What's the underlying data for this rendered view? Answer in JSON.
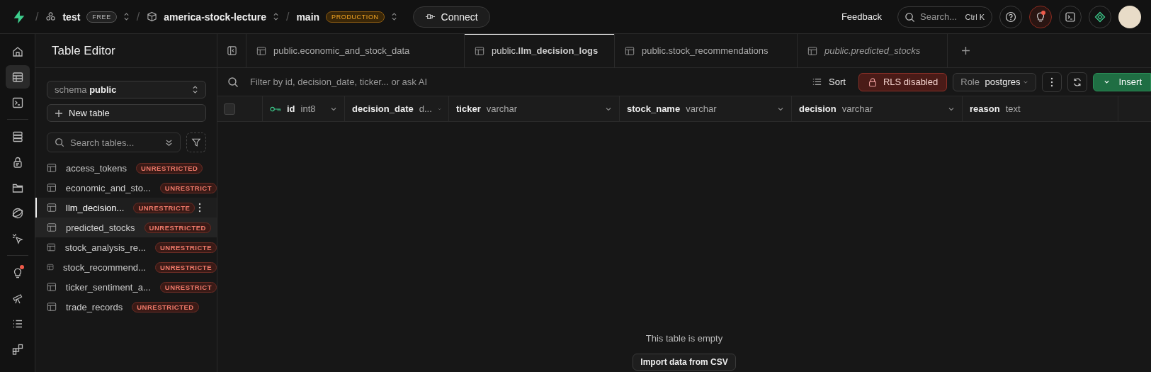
{
  "top_bar": {
    "separator": "/",
    "breadcrumbs": [
      {
        "kind": "org",
        "label": "test",
        "badge": "FREE"
      },
      {
        "kind": "project",
        "label": "america-stock-lecture"
      },
      {
        "kind": "branch",
        "label": "main",
        "badge": "PRODUCTION"
      }
    ],
    "connect_button": "Connect",
    "feedback": "Feedback",
    "search": {
      "placeholder": "Search...",
      "shortcut": "Ctrl K"
    },
    "actions": [
      {
        "kind": "help",
        "notification": false
      },
      {
        "kind": "bulb",
        "notification": true
      },
      {
        "kind": "terminal",
        "notification": false
      },
      {
        "kind": "diamond",
        "notification": false
      }
    ]
  },
  "rail": [
    {
      "kind": "home",
      "selected": false,
      "notification": false
    },
    {
      "kind": "table",
      "selected": true,
      "notification": false
    },
    {
      "kind": "terminal",
      "selected": false,
      "notification": false
    },
    {
      "kind": "sep"
    },
    {
      "kind": "database",
      "selected": false,
      "notification": false
    },
    {
      "kind": "lock",
      "selected": false,
      "notification": false
    },
    {
      "kind": "folder",
      "selected": false,
      "notification": false
    },
    {
      "kind": "globe",
      "selected": false,
      "notification": false
    },
    {
      "kind": "cursor",
      "selected": false,
      "notification": false
    },
    {
      "kind": "sep"
    },
    {
      "kind": "bulb",
      "selected": false,
      "notification": true
    },
    {
      "kind": "telescope",
      "selected": false,
      "notification": false
    },
    {
      "kind": "list",
      "selected": false,
      "notification": false
    },
    {
      "kind": "blocks",
      "selected": false,
      "notification": false
    }
  ],
  "sidebar": {
    "title": "Table Editor",
    "schema": {
      "label": "schema",
      "value": "public"
    },
    "new_table": "New table",
    "search": {
      "placeholder": "Search tables..."
    },
    "items": [
      {
        "name": "access_tokens",
        "badge": "UNRESTRICTED",
        "selected": false,
        "hovered": false
      },
      {
        "name": "economic_and_sto...",
        "badge": "UNRESTRICT",
        "selected": false,
        "hovered": false
      },
      {
        "name": "llm_decision...",
        "badge": "UNRESTRICTE",
        "selected": true,
        "hovered": false
      },
      {
        "name": "predicted_stocks",
        "badge": "UNRESTRICTED",
        "selected": false,
        "hovered": true
      },
      {
        "name": "stock_analysis_re...",
        "badge": "UNRESTRICTE",
        "selected": false,
        "hovered": false
      },
      {
        "name": "stock_recommend...",
        "badge": "UNRESTRICTE",
        "selected": false,
        "hovered": false
      },
      {
        "name": "ticker_sentiment_a...",
        "badge": "UNRESTRICT",
        "selected": false,
        "hovered": false
      },
      {
        "name": "trade_records",
        "badge": "UNRESTRICTED",
        "selected": false,
        "hovered": false
      }
    ]
  },
  "tabs": [
    {
      "label": "public.economic_and_stock_data",
      "selected": false,
      "preview": false
    },
    {
      "label": "public.**llm_decision_logs**",
      "selected": true,
      "preview": false
    },
    {
      "label": "public.stock_recommendations",
      "selected": false,
      "preview": false
    },
    {
      "label": "public.predicted_stocks",
      "selected": false,
      "preview": true
    }
  ],
  "toolbar": {
    "filter": {
      "placeholder": "Filter by id, decision_date, ticker... or ask AI"
    },
    "sort": "Sort",
    "rls": "RLS disabled",
    "role": {
      "label": "Role",
      "value": "postgres"
    },
    "insert": "Insert"
  },
  "table": {
    "select_all": {
      "checked": false
    },
    "columns": [
      {
        "name": "id",
        "type": "int8",
        "primary_key": true
      },
      {
        "name": "decision_date",
        "type": "d...",
        "primary_key": false
      },
      {
        "name": "ticker",
        "type": "varchar",
        "primary_key": false
      },
      {
        "name": "stock_name",
        "type": "varchar",
        "primary_key": false
      },
      {
        "name": "decision",
        "type": "varchar",
        "primary_key": false
      },
      {
        "name": "reason",
        "type": "text",
        "primary_key": false
      }
    ],
    "empty_message": "This table is empty",
    "import_button": "Import data from CSV"
  }
}
